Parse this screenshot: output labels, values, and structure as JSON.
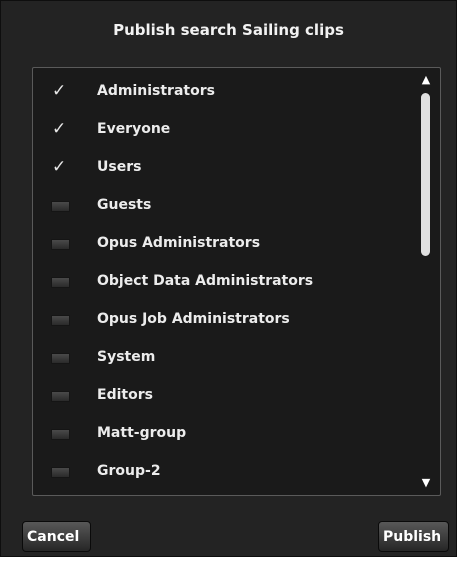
{
  "dialog": {
    "title": "Publish search Sailing clips",
    "groups": [
      {
        "label": "Administrators",
        "checked": true
      },
      {
        "label": "Everyone",
        "checked": true
      },
      {
        "label": "Users",
        "checked": true
      },
      {
        "label": "Guests",
        "checked": false
      },
      {
        "label": "Opus Administrators",
        "checked": false
      },
      {
        "label": "Object Data Administrators",
        "checked": false
      },
      {
        "label": "Opus Job Administrators",
        "checked": false
      },
      {
        "label": "System",
        "checked": false
      },
      {
        "label": "Editors",
        "checked": false
      },
      {
        "label": "Matt-group",
        "checked": false
      },
      {
        "label": "Group-2",
        "checked": false
      }
    ],
    "cancel_label": "Cancel",
    "publish_label": "Publish"
  },
  "icons": {
    "checked": "checkmark-icon",
    "unchecked": "unchecked-box-icon",
    "scroll_up": "arrow-up-icon",
    "scroll_down": "arrow-down-icon"
  },
  "colors": {
    "dialog_bg": "#232323",
    "list_bg": "#1a1a1a",
    "text": "#ececec",
    "scroll_thumb": "#e0e0e0"
  }
}
